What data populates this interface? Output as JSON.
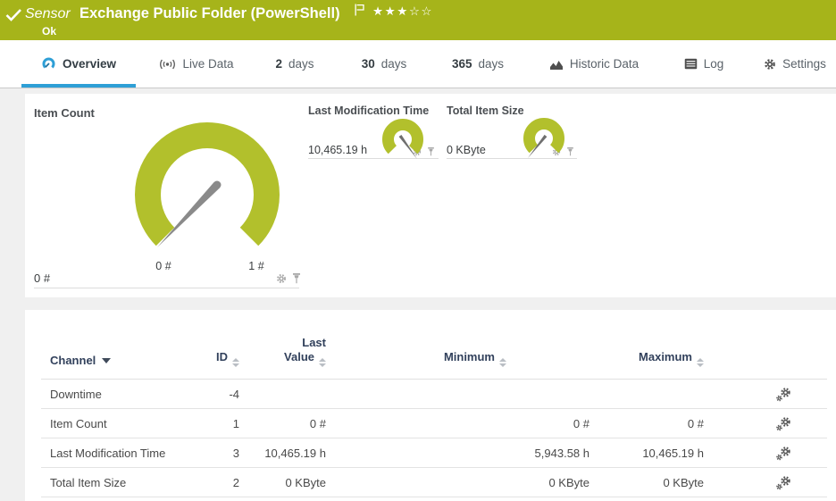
{
  "header": {
    "type_label": "Sensor",
    "title": "Exchange Public Folder (PowerShell)",
    "status": "Ok",
    "rating_filled": "★★★",
    "rating_empty": "☆☆"
  },
  "tabs": {
    "overview": "Overview",
    "live_data": "Live Data",
    "days2_num": "2",
    "days2_label": "days",
    "days30_num": "30",
    "days30_label": "days",
    "days365_num": "365",
    "days365_label": "days",
    "historic_data": "Historic Data",
    "log": "Log",
    "settings": "Settings"
  },
  "gauges": {
    "item_count": {
      "title": "Item Count",
      "value": "0 #",
      "scale_min": "0 #",
      "scale_max": "1 #"
    },
    "last_modification_time": {
      "title": "Last Modification Time",
      "value": "10,465.19 h"
    },
    "total_item_size": {
      "title": "Total Item Size",
      "value": "0 KByte"
    }
  },
  "table": {
    "headers": {
      "channel": "Channel",
      "id": "ID",
      "last_value": "Last Value",
      "minimum": "Minimum",
      "maximum": "Maximum"
    },
    "rows": [
      {
        "channel": "Downtime",
        "id": "-4",
        "last_value": "",
        "minimum": "",
        "maximum": ""
      },
      {
        "channel": "Item Count",
        "id": "1",
        "last_value": "0 #",
        "minimum": "0 #",
        "maximum": "0 #"
      },
      {
        "channel": "Last Modification Time",
        "id": "3",
        "last_value": "10,465.19 h",
        "minimum": "5,943.58 h",
        "maximum": "10,465.19 h"
      },
      {
        "channel": "Total Item Size",
        "id": "2",
        "last_value": "0 KByte",
        "minimum": "0 KByte",
        "maximum": "0 KByte"
      }
    ]
  },
  "colors": {
    "status_ok_green": "#a6b41a",
    "gauge_green": "#b2c02c",
    "accent_blue": "#2e9fd6"
  }
}
